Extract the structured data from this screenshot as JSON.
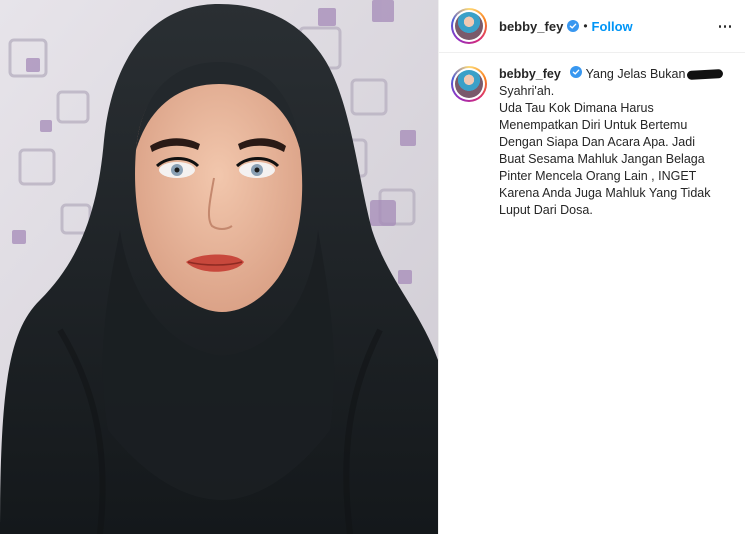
{
  "post": {
    "username": "bebby_fey",
    "follow_label": "Follow",
    "separator": "•",
    "more_icon": "more-horizontal-icon",
    "verified_icon": "verified-badge-icon",
    "caption": {
      "username": "bebby_fey",
      "first_line": "Yang Jelas Bukan",
      "lines": [
        "Syahri'ah.",
        "Uda Tau Kok Dimana Harus",
        "Menempatkan Diri Untuk Bertemu",
        "Dengan Siapa Dan Acara Apa. Jadi",
        "Buat Sesama Mahluk Jangan Belaga",
        "Pinter Mencela Orang Lain , INGET",
        "Karena Anda Juga Mahluk Yang Tidak",
        "Luput Dari Dosa."
      ]
    }
  },
  "colors": {
    "follow": "#0095f6",
    "verified": "#3897f0",
    "hijab": "#1f2326",
    "wall": "#dcd8de",
    "wall_accent": "#a58bb8"
  }
}
